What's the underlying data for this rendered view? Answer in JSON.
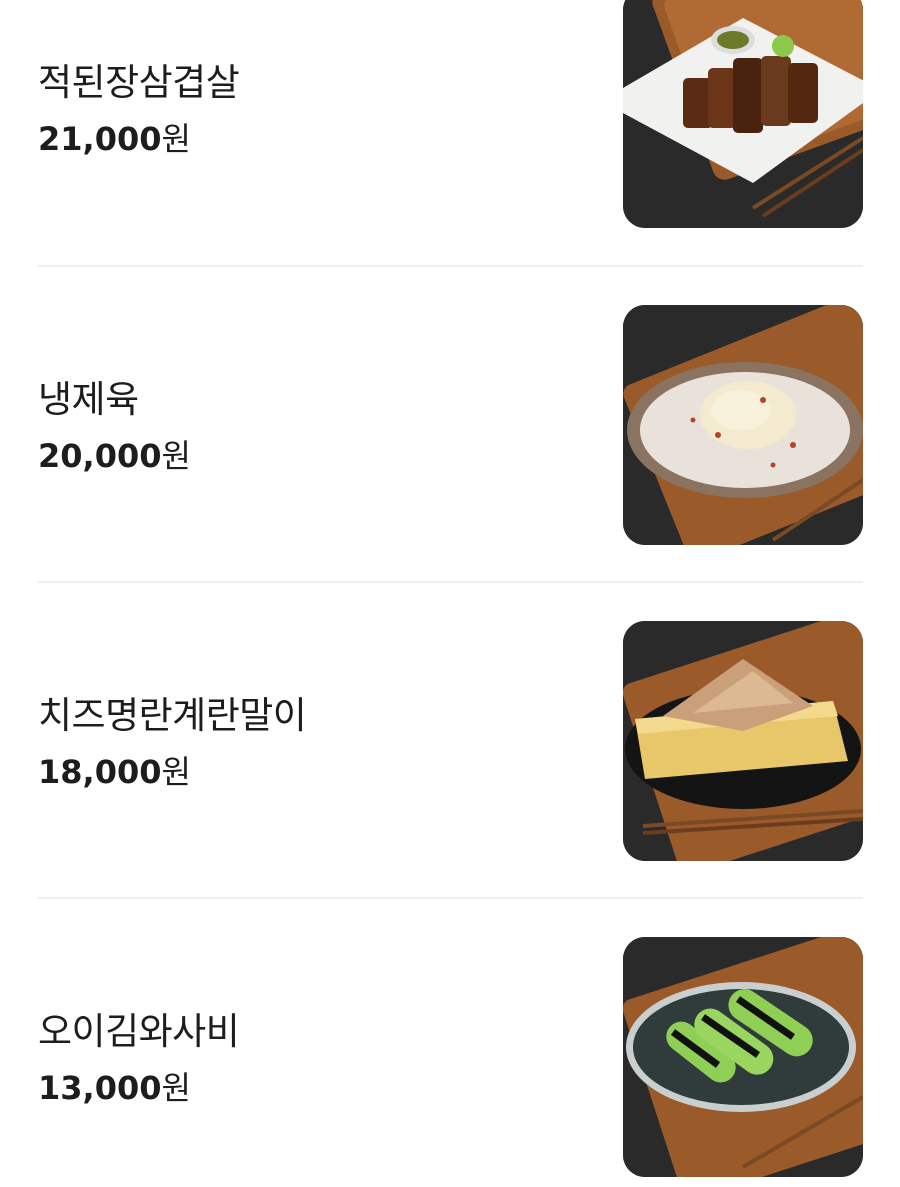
{
  "menu": {
    "items": [
      {
        "name": "적된장삼겹살",
        "price": "21,000",
        "currency": "원",
        "image": "grilled-pork-belly-image"
      },
      {
        "name": "냉제육",
        "price": "20,000",
        "currency": "원",
        "image": "cold-sliced-pork-image"
      },
      {
        "name": "치즈명란계란말이",
        "price": "18,000",
        "currency": "원",
        "image": "rolled-omelette-image"
      },
      {
        "name": "오이김와사비",
        "price": "13,000",
        "currency": "원",
        "image": "cucumber-seaweed-wasabi-image"
      }
    ]
  },
  "colors": {
    "text": "#1d1d1f",
    "divider": "#efefef",
    "thumb_background": "#262626",
    "board_wood": "#9b5a2a"
  }
}
